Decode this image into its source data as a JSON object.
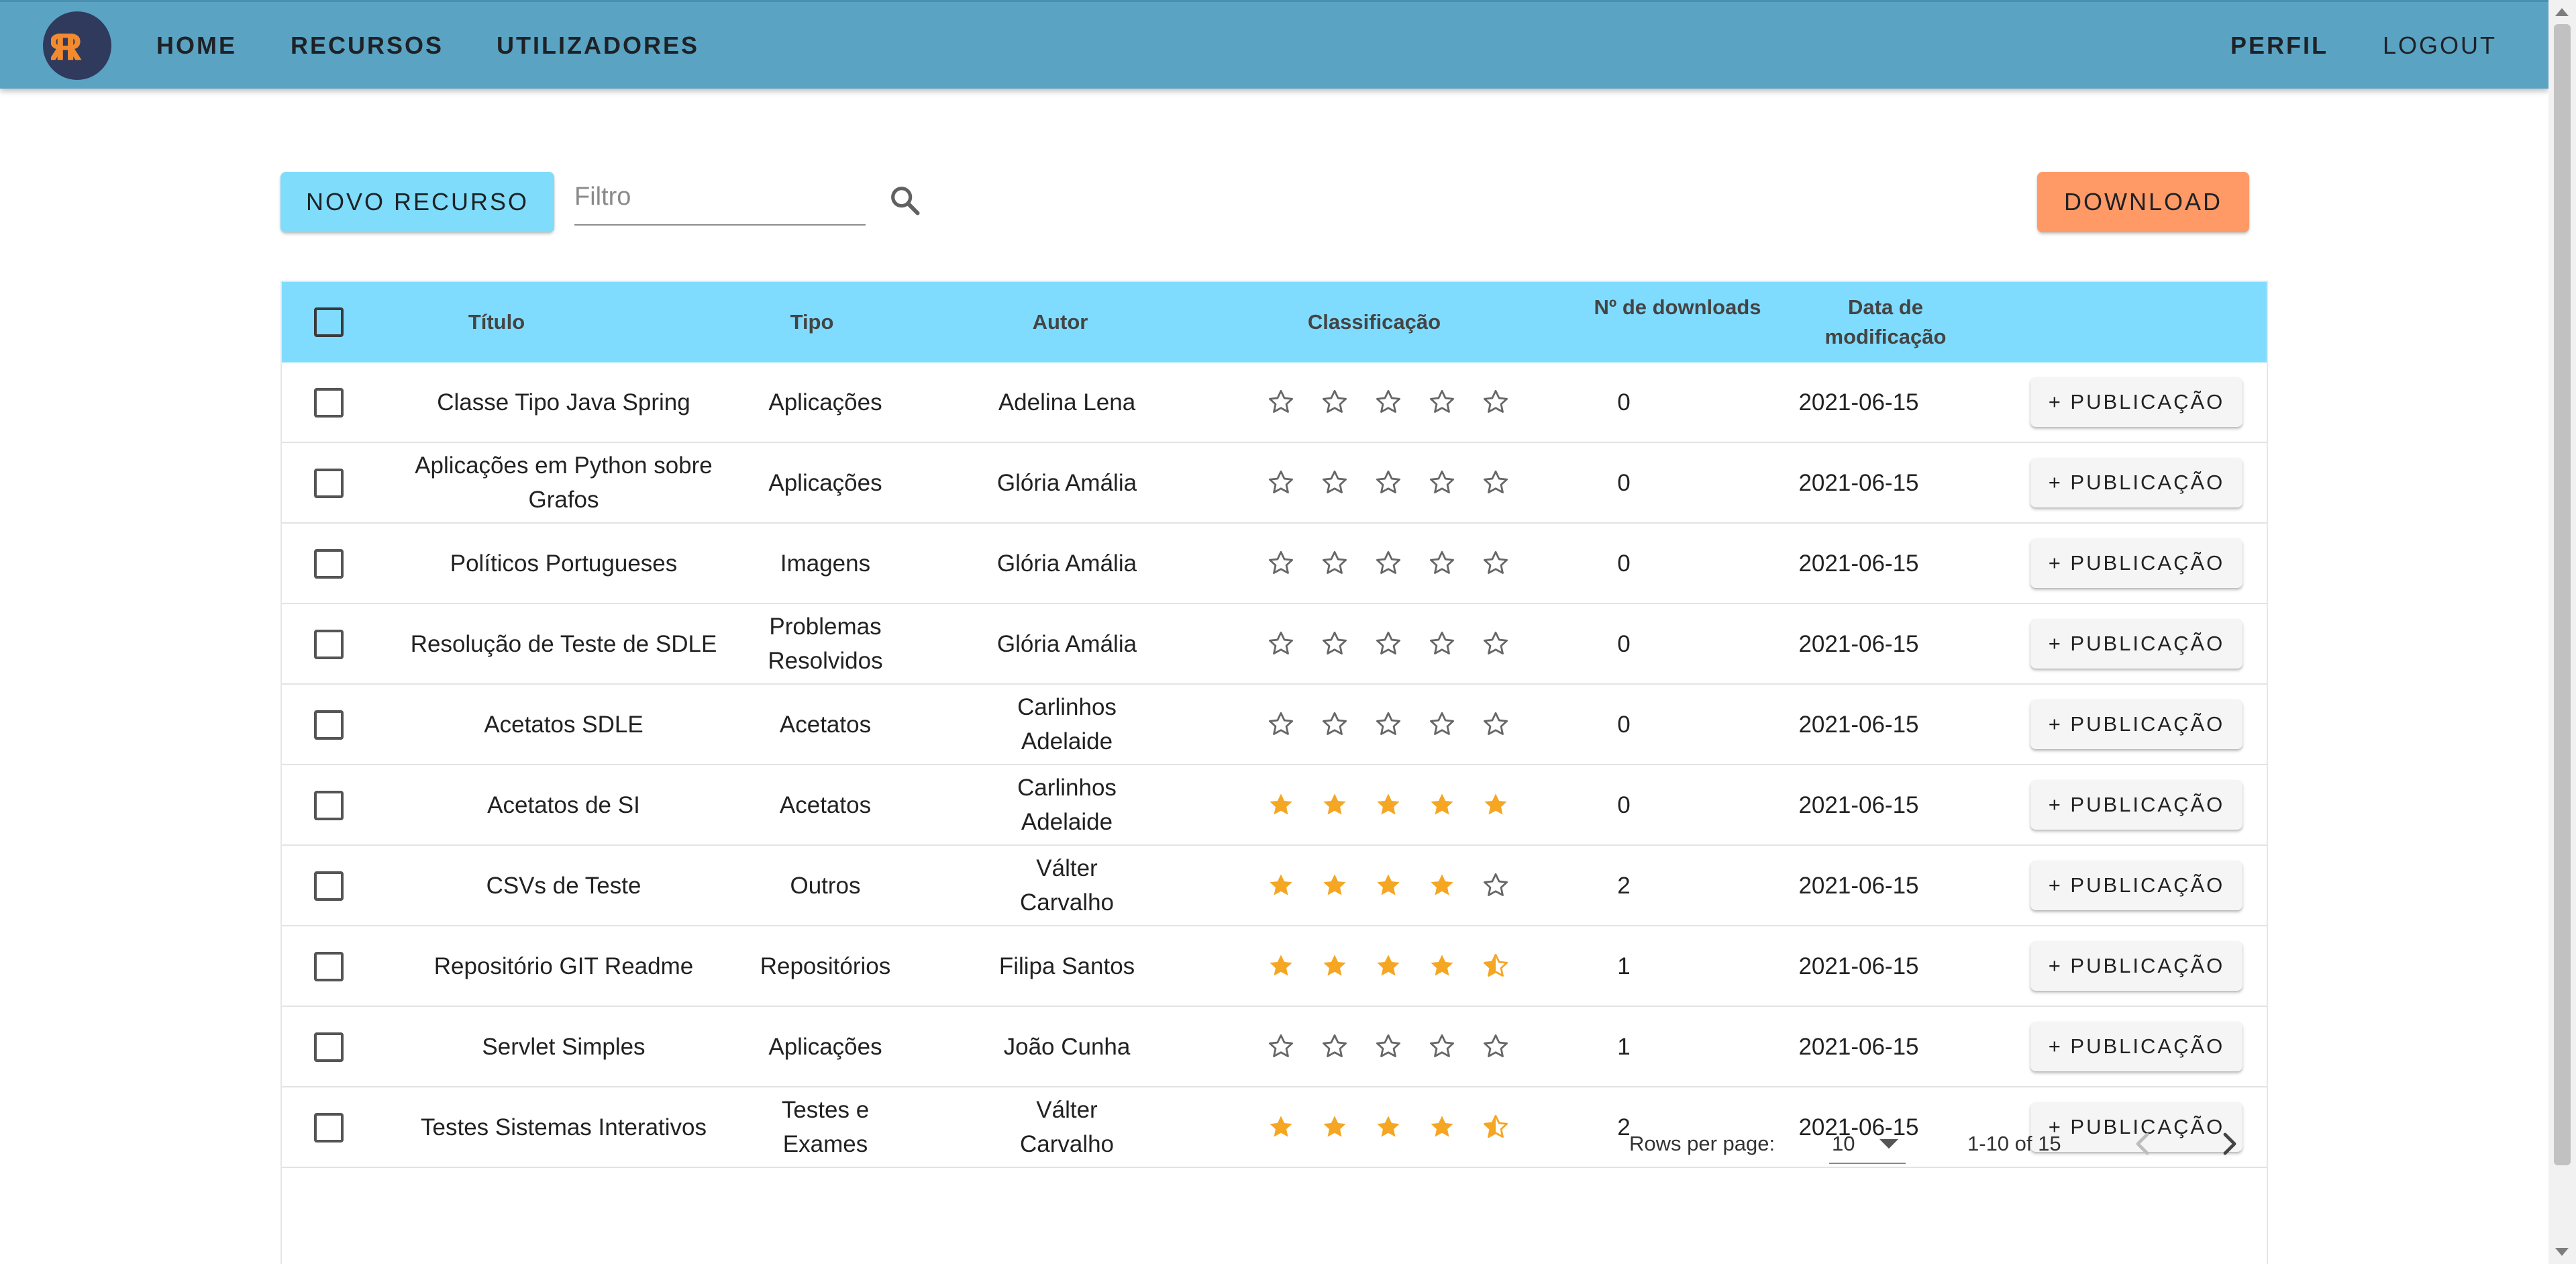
{
  "nav": {
    "home": "HOME",
    "recursos": "RECURSOS",
    "utilizadores": "UTILIZADORES",
    "perfil": "PERFIL",
    "logout": "LOGOUT"
  },
  "colors": {
    "appbar": "#5aa3c3",
    "header_row": "#80dcff",
    "new_button": "#7fdcfa",
    "download_button": "#ff9a66",
    "star_filled": "#f5a623",
    "logo_bg": "#2f3a5c",
    "logo_letters": "#f28b30"
  },
  "toolbar": {
    "new_label": "NOVO RECURSO",
    "filter_placeholder": "Filtro",
    "download_label": "DOWNLOAD"
  },
  "table": {
    "headers": {
      "titulo": "Título",
      "tipo": "Tipo",
      "autor": "Autor",
      "classificacao": "Classificação",
      "downloads": "Nº de downloads",
      "data": "Data de modificação"
    },
    "publish_label": "+ PUBLICAÇÃO",
    "rows": [
      {
        "titulo": "Classe Tipo Java Spring",
        "tipo": "Aplicações",
        "autor": "Adelina Lena",
        "rating": 0,
        "downloads": "0",
        "data": "2021-06-15"
      },
      {
        "titulo": "Aplicações em Python sobre Grafos",
        "tipo": "Aplicações",
        "autor": "Glória Amália",
        "rating": 0,
        "downloads": "0",
        "data": "2021-06-15"
      },
      {
        "titulo": "Políticos Portugueses",
        "tipo": "Imagens",
        "autor": "Glória Amália",
        "rating": 0,
        "downloads": "0",
        "data": "2021-06-15"
      },
      {
        "titulo": "Resolução de Teste de SDLE",
        "tipo": "Problemas Resolvidos",
        "autor": "Glória Amália",
        "rating": 0,
        "downloads": "0",
        "data": "2021-06-15"
      },
      {
        "titulo": "Acetatos SDLE",
        "tipo": "Acetatos",
        "autor": "Carlinhos Adelaide",
        "rating": 0,
        "downloads": "0",
        "data": "2021-06-15"
      },
      {
        "titulo": "Acetatos de SI",
        "tipo": "Acetatos",
        "autor": "Carlinhos Adelaide",
        "rating": 5,
        "downloads": "0",
        "data": "2021-06-15"
      },
      {
        "titulo": "CSVs de Teste",
        "tipo": "Outros",
        "autor": "Válter Carvalho",
        "rating": 4,
        "downloads": "2",
        "data": "2021-06-15"
      },
      {
        "titulo": "Repositório GIT Readme",
        "tipo": "Repositórios",
        "autor": "Filipa Santos",
        "rating": 4.5,
        "downloads": "1",
        "data": "2021-06-15"
      },
      {
        "titulo": "Servlet Simples",
        "tipo": "Aplicações",
        "autor": "João Cunha",
        "rating": 0,
        "downloads": "1",
        "data": "2021-06-15"
      },
      {
        "titulo": "Testes Sistemas Interativos",
        "tipo": "Testes e Exames",
        "autor": "Válter Carvalho",
        "rating": 4.5,
        "downloads": "2",
        "data": "2021-06-15"
      }
    ]
  },
  "pagination": {
    "rows_per_page_label": "Rows per page:",
    "rows_per_page_value": "10",
    "range": "1-10 of 15"
  }
}
